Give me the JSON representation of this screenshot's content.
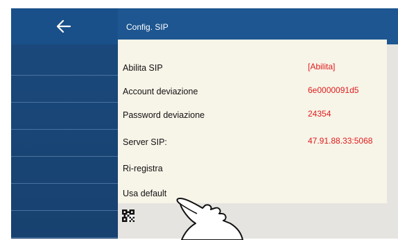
{
  "header": {
    "title": "Config. SIP"
  },
  "sidebar": {
    "back_icon": "arrow-left-icon",
    "item_count": 7
  },
  "settings": [
    {
      "label": "Abilita SIP",
      "value": "[Abilita]"
    },
    {
      "label": "Account deviazione",
      "value": "6e0000091d5"
    },
    {
      "label": "Password deviazione",
      "value": "24354"
    },
    {
      "label": "Server SIP:",
      "value": "47.91.88.33:5068"
    },
    {
      "label": "Ri-registra",
      "value": ""
    },
    {
      "label": "Usa default",
      "value": ""
    }
  ],
  "footer": {
    "qr_icon": "qr-code-icon"
  },
  "colors": {
    "sidebar": "#17416f",
    "header": "#1d5690",
    "panel": "#f7f4e8",
    "value_text": "#e01b1b"
  }
}
